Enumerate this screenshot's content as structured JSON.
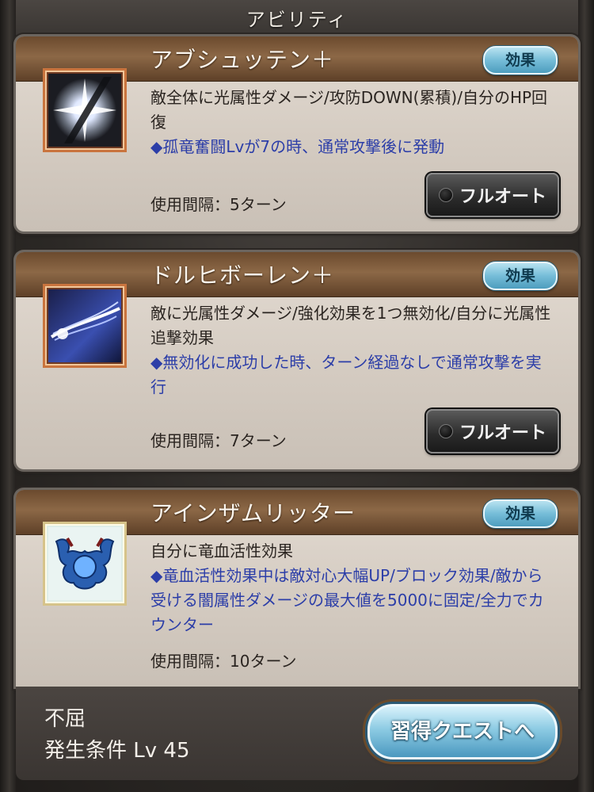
{
  "header": {
    "title": "アビリティ"
  },
  "abilities": [
    {
      "name": "アブシュッテン＋",
      "effect_label": "効果",
      "description": "敵全体に光属性ダメージ/攻防DOWN(累積)/自分のHP回復",
      "note": "◆孤竜奮闘Lvが7の時、通常攻撃後に発動",
      "cooldown": "使用間隔：5ターン",
      "auto_label": "フルオート",
      "icon": "light-burst-icon"
    },
    {
      "name": "ドルヒボーレン＋",
      "effect_label": "効果",
      "description": "敵に光属性ダメージ/強化効果を1つ無効化/自分に光属性追撃効果",
      "note": "◆無効化に成功した時、ターン経過なしで通常攻撃を実行",
      "cooldown": "使用間隔：7ターン",
      "auto_label": "フルオート",
      "icon": "light-slash-icon"
    },
    {
      "name": "アインザムリッター",
      "effect_label": "効果",
      "description": "自分に竜血活性効果",
      "note": "◆竜血活性効果中は敵対心大幅UP/ブロック効果/敵から受ける闇属性ダメージの最大値を5000に固定/全力でカウンター",
      "cooldown": "使用間隔：10ターン",
      "icon": "dragon-crest-icon"
    }
  ],
  "footer": {
    "name": "不屈",
    "condition": "発生条件 Lv 45",
    "quest_button": "習得クエストへ"
  }
}
